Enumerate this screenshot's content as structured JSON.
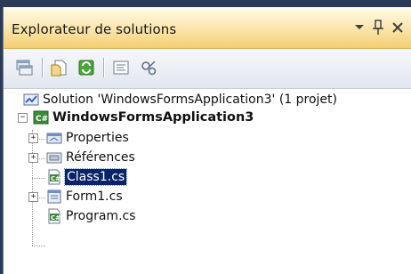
{
  "panel": {
    "title": "Explorateur de solutions"
  },
  "titlebar_buttons": {
    "dropdown": "chevron-down-icon",
    "pin": "pin-icon",
    "close": "close-icon"
  },
  "toolbar": {
    "items": [
      "properties-icon",
      "show-all-files-icon",
      "refresh-icon",
      "view-code-icon",
      "class-diagram-icon"
    ]
  },
  "tree": {
    "solution": "Solution 'WindowsFormsApplication3' (1 projet)",
    "project": "WindowsFormsApplication3",
    "items": [
      {
        "label": "Properties",
        "icon": "properties-folder-icon",
        "expandable": true
      },
      {
        "label": "Références",
        "icon": "references-folder-icon",
        "expandable": true
      },
      {
        "label": "Class1.cs",
        "icon": "csharp-file-icon",
        "expandable": false,
        "selected": true
      },
      {
        "label": "Form1.cs",
        "icon": "form-file-icon",
        "expandable": true
      },
      {
        "label": "Program.cs",
        "icon": "csharp-file-icon",
        "expandable": false
      }
    ]
  },
  "colors": {
    "title_gradient_top": "#fffbe9",
    "title_gradient_bottom": "#f3cf73",
    "selection": "#0a246a",
    "background_frame": "#2b3b57"
  }
}
